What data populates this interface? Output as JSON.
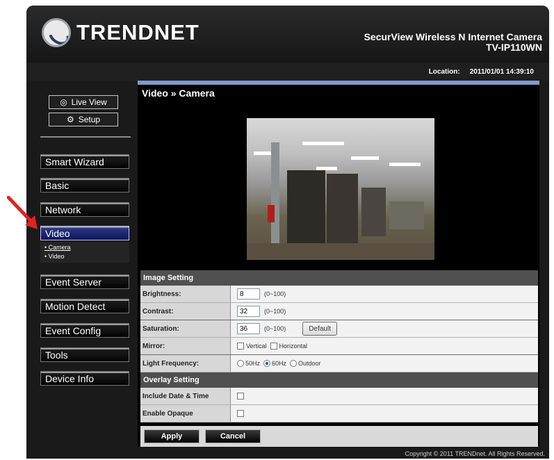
{
  "brand": {
    "logo_text": "TRENDNET"
  },
  "product": {
    "line1": "SecurView Wireless N Internet Camera",
    "line2": "TV-IP110WN"
  },
  "location": {
    "label": "Location:",
    "value": "2011/01/01 14:39:10"
  },
  "view_buttons": [
    {
      "label": "Live View",
      "icon": "eye-icon"
    },
    {
      "label": "Setup",
      "icon": "gear-icon"
    }
  ],
  "nav": {
    "smart_wizard": "Smart Wizard",
    "basic": "Basic",
    "network": "Network",
    "video": "Video",
    "event_server": "Event Server",
    "motion_detect": "Motion Detect",
    "event_config": "Event Config",
    "tools": "Tools",
    "device_info": "Device Info"
  },
  "submenu": {
    "camera": "• Camera",
    "video": "• Video"
  },
  "content": {
    "title": "Video » Camera"
  },
  "image_setting": {
    "header": "Image Setting",
    "brightness": {
      "label": "Brightness:",
      "value": "8",
      "range": "(0~100)"
    },
    "contrast": {
      "label": "Contrast:",
      "value": "32",
      "range": "(0~100)"
    },
    "saturation": {
      "label": "Saturation:",
      "value": "36",
      "range": "(0~100)",
      "default_button": "Default"
    },
    "mirror": {
      "label": "Mirror:",
      "vertical": "Vertical",
      "horizontal": "Horizontal"
    },
    "light_frequency": {
      "label": "Light Frequency:",
      "opt1": "50Hz",
      "opt2": "60Hz",
      "opt3": "Outdoor",
      "selected": "60Hz"
    }
  },
  "overlay_setting": {
    "header": "Overlay Setting",
    "date_time": "Include Date & Time",
    "opaque": "Enable Opaque"
  },
  "buttons": {
    "apply": "Apply",
    "cancel": "Cancel"
  },
  "footer": {
    "copyright": "Copyright © 2011 TRENDnet. All Rights Reserved."
  },
  "colors": {
    "accent_blue": "#1e2a7a",
    "header_blue_line": "#7a9ccc",
    "annotation_arrow": "#e32222"
  }
}
